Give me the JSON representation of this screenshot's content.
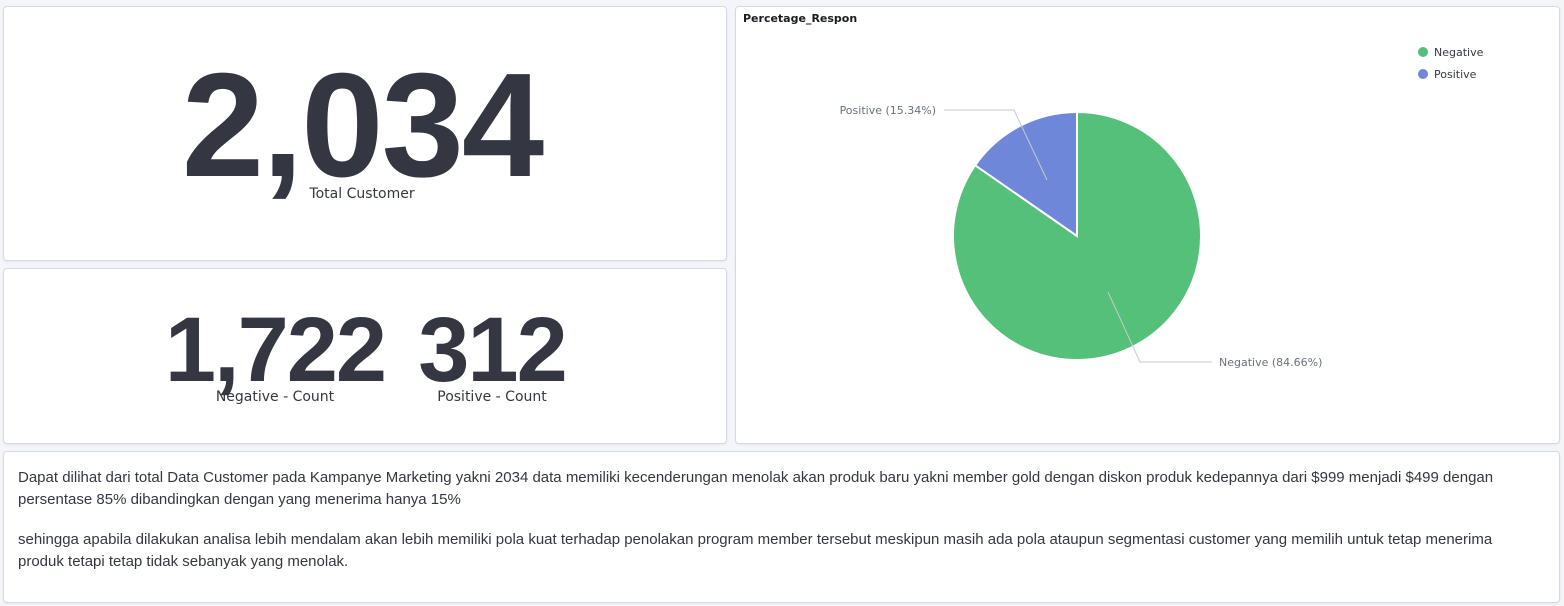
{
  "total_customer": {
    "value": "2,034",
    "label": "Total Customer"
  },
  "counts": {
    "negative_value": "1,722",
    "negative_label": "Negative - Count",
    "positive_value": "312",
    "positive_label": "Positive - Count"
  },
  "pie_panel": {
    "title": "Percetage_Respon",
    "legend": [
      {
        "label": "Negative",
        "color": "#54c07a"
      },
      {
        "label": "Positive",
        "color": "#6e87d8"
      }
    ]
  },
  "chart_data": {
    "type": "pie",
    "title": "Percetage_Respon",
    "slices": [
      {
        "name": "Negative",
        "value": 84.66,
        "label": "Negative (84.66%)",
        "color": "#54c07a"
      },
      {
        "name": "Positive",
        "value": 15.34,
        "label": "Positive (15.34%)",
        "color": "#6e87d8"
      }
    ],
    "legend_position": "top-right"
  },
  "description": {
    "paragraph1": "Dapat dilihat dari total Data Customer pada Kampanye Marketing yakni 2034 data memiliki kecenderungan menolak akan produk baru yakni member gold dengan diskon produk kedepannya dari $999 menjadi $499 dengan persentase 85% dibandingkan dengan yang menerima hanya 15%",
    "paragraph2": "sehingga apabila dilakukan analisa lebih mendalam akan lebih memiliki pola kuat terhadap penolakan program member tersebut meskipun masih ada pola ataupun segmentasi customer yang memilih untuk tetap menerima produk tetapi tetap tidak sebanyak yang menolak."
  }
}
